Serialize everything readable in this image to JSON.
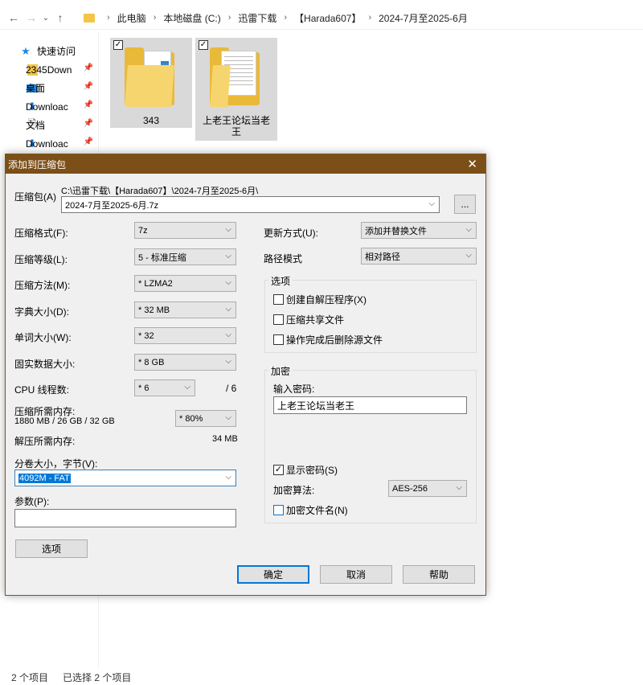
{
  "explorer": {
    "breadcrumbs": [
      "此电脑",
      "本地磁盘 (C:)",
      "迅雷下载",
      "【Harada607】",
      "2024-7月至2025-6月"
    ],
    "nav_items": [
      {
        "label": "快速访问",
        "icon": "star-icon",
        "pinned": false
      },
      {
        "label": "2345Down",
        "icon": "folder-icon",
        "pinned": true
      },
      {
        "label": "桌面",
        "icon": "desktop-icon",
        "pinned": true
      },
      {
        "label": "Downloac",
        "icon": "download-icon",
        "pinned": true
      },
      {
        "label": "文档",
        "icon": "document-icon",
        "pinned": true
      },
      {
        "label": "Downloac",
        "icon": "download-icon",
        "pinned": true
      }
    ],
    "files": [
      {
        "name": "343"
      },
      {
        "name": "上老王论坛当老王"
      }
    ],
    "status": {
      "count": "2 个项目",
      "selected": "已选择 2 个项目"
    }
  },
  "dialog": {
    "title": "添加到压缩包",
    "archive_label": "压缩包(A)",
    "archive_path": "C:\\迅雷下载\\【Harada607】\\2024-7月至2025-6月\\",
    "archive_name": "2024-7月至2025-6月.7z",
    "browse_label": "...",
    "left": {
      "format_label": "压缩格式(F):",
      "format_value": "7z",
      "level_label": "压缩等级(L):",
      "level_value": "5 - 标准压缩",
      "method_label": "压缩方法(M):",
      "method_value": "* LZMA2",
      "dict_label": "字典大小(D):",
      "dict_value": "* 32 MB",
      "word_label": "单词大小(W):",
      "word_value": "* 32",
      "solid_label": "固实数据大小:",
      "solid_value": "* 8 GB",
      "threads_label": "CPU 线程数:",
      "threads_value": "* 6",
      "threads_total": "/ 6",
      "mem_label": "压缩所需内存:",
      "mem_detail": "1880 MB / 26 GB / 32 GB",
      "mem_value": "* 80%",
      "decomp_label": "解压所需内存:",
      "decomp_value": "34 MB",
      "split_label": "分卷大小，字节(V):",
      "split_value": "4092M - FAT",
      "params_label": "参数(P):",
      "params_value": "",
      "options_button": "选项"
    },
    "right": {
      "update_label": "更新方式(U):",
      "update_value": "添加并替换文件",
      "path_label": "路径模式",
      "path_value": "相对路径",
      "options_group": "选项",
      "opt_sfx": "创建自解压程序(X)",
      "opt_shared": "压缩共享文件",
      "opt_delete": "操作完成后删除源文件",
      "encrypt_group": "加密",
      "password_label": "输入密码:",
      "password_value": "上老王论坛当老王",
      "show_password": "显示密码(S)",
      "enc_method_label": "加密算法:",
      "enc_method_value": "AES-256",
      "encrypt_names": "加密文件名(N)"
    },
    "buttons": {
      "ok": "确定",
      "cancel": "取消",
      "help": "帮助"
    }
  }
}
